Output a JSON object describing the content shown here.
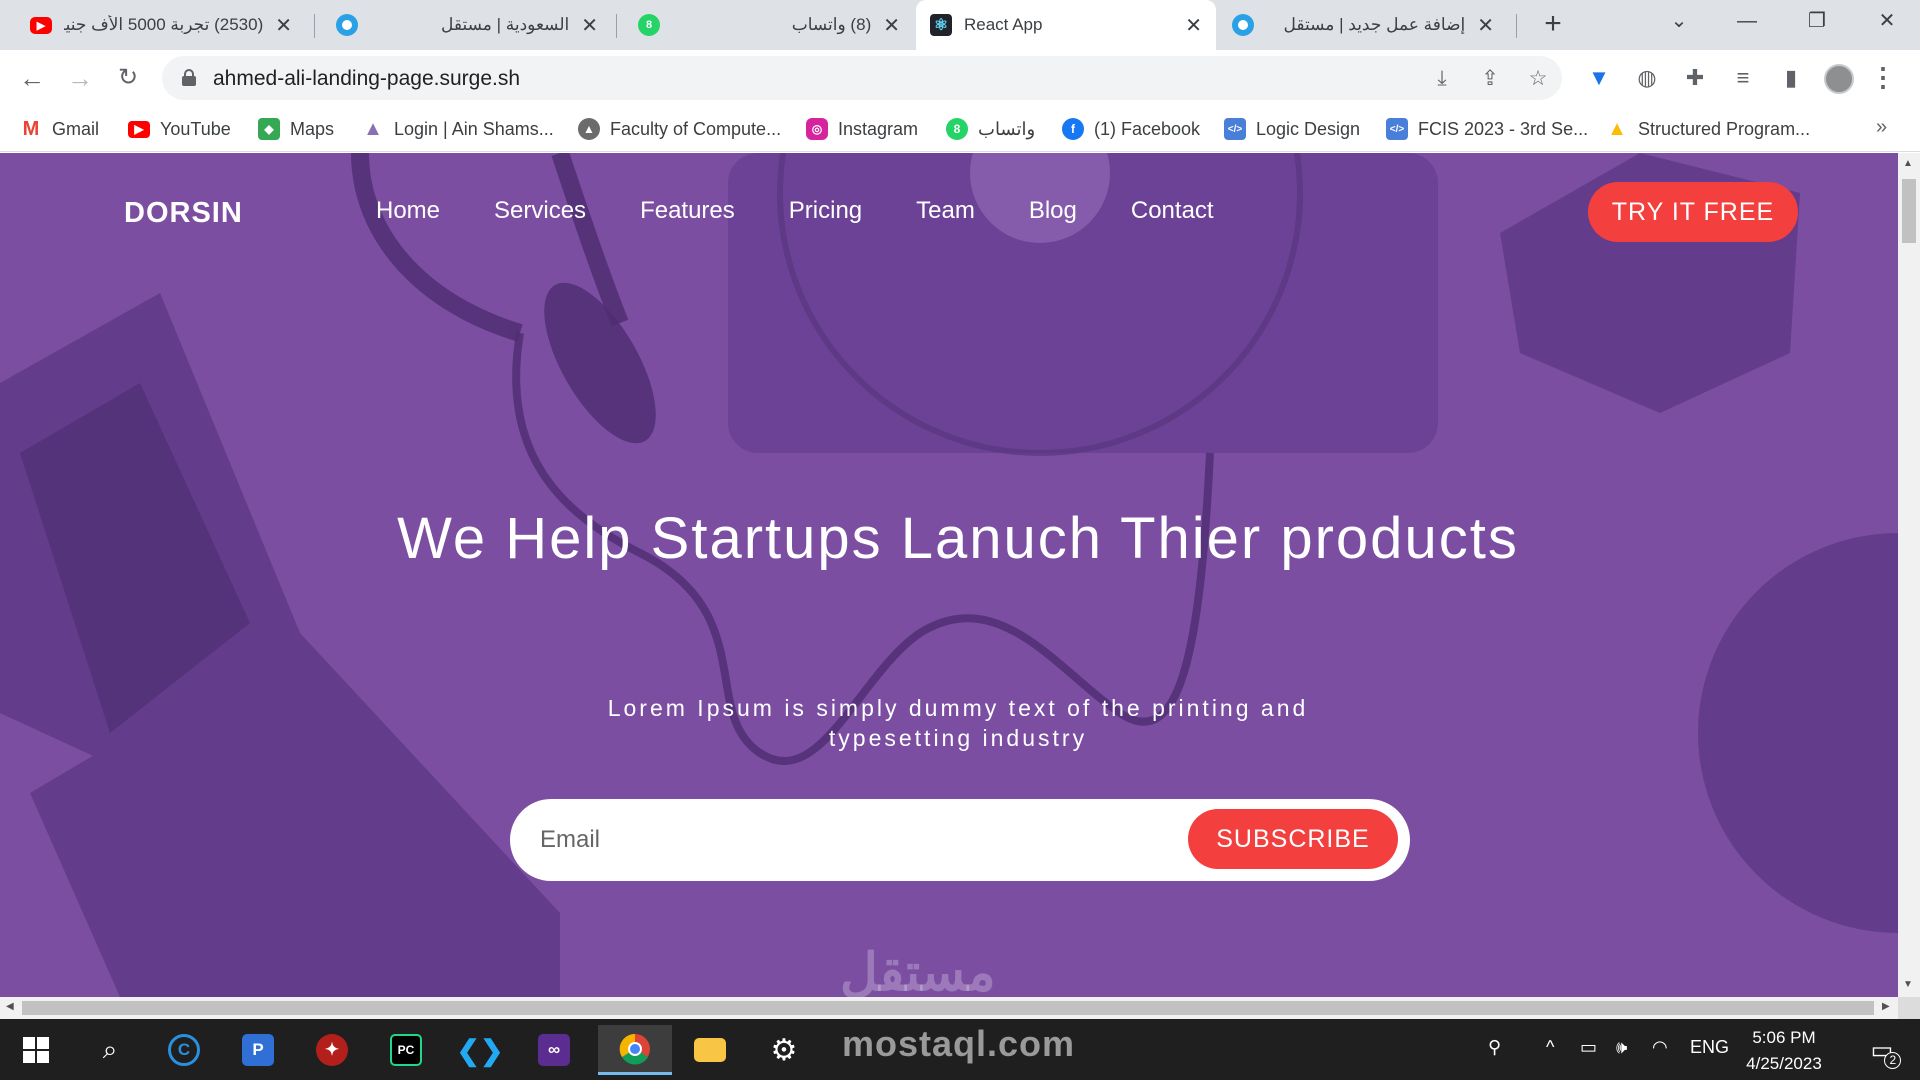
{
  "browser": {
    "tabs": [
      {
        "title": "(2530) تجربة 5000 الأف جنيه",
        "icon": "youtube-icon",
        "color": "#ff0000"
      },
      {
        "title": "السعودية | مستقل",
        "icon": "mostaql-icon",
        "color": "#2aa1e6"
      },
      {
        "title": "(8) واتساب",
        "icon": "whatsapp-icon",
        "color": "#25d366"
      },
      {
        "title": "React App",
        "icon": "react-icon",
        "color": "#61dafb"
      },
      {
        "title": "إضافة عمل جديد | مستقل",
        "icon": "mostaql-icon",
        "color": "#2aa1e6"
      }
    ],
    "new_tab": "+",
    "url": "ahmed-ali-landing-page.surge.sh",
    "bookmarks": [
      {
        "label": "Gmail",
        "icon": "gmail-icon",
        "color": "#ea4335"
      },
      {
        "label": "YouTube",
        "icon": "youtube-icon",
        "color": "#ff0000"
      },
      {
        "label": "Maps",
        "icon": "maps-icon",
        "color": "#34a853"
      },
      {
        "label": "Login | Ain Shams...",
        "icon": "university-icon",
        "color": "#8a6fb3"
      },
      {
        "label": "Faculty of Compute...",
        "icon": "faculty-icon",
        "color": "#6b6b6b"
      },
      {
        "label": "Instagram",
        "icon": "instagram-icon",
        "color": "#d6249f"
      },
      {
        "label": "واتساب",
        "icon": "whatsapp-icon",
        "color": "#25d366"
      },
      {
        "label": "(1) Facebook",
        "icon": "facebook-icon",
        "color": "#1877f2"
      },
      {
        "label": "Logic Design",
        "icon": "code-icon",
        "color": "#4a7fd9"
      },
      {
        "label": "FCIS 2023 - 3rd Se...",
        "icon": "code-icon",
        "color": "#4a7fd9"
      },
      {
        "label": "Structured Program...",
        "icon": "drive-icon",
        "color": "#fbbc04"
      }
    ],
    "more": "»"
  },
  "page": {
    "logo": "DORSIN",
    "nav": [
      "Home",
      "Services",
      "Features",
      "Pricing",
      "Team",
      "Blog",
      "Contact"
    ],
    "cta": "TRY IT FREE",
    "hero_title": "We Help Startups Lanuch Thier products",
    "hero_subtitle": "Lorem Ipsum is simply dummy text of the printing and typesetting industry",
    "email_placeholder": "Email",
    "subscribe_label": "SUBSCRIBE",
    "watermark": "مستقل",
    "colors": {
      "overlay": "#7b4ea2",
      "accent": "#f43f3f"
    }
  },
  "taskbar": {
    "watermark": "mostaql.com",
    "language": "ENG",
    "time": "5:06 PM",
    "date": "4/25/2023",
    "notifications": "2"
  }
}
